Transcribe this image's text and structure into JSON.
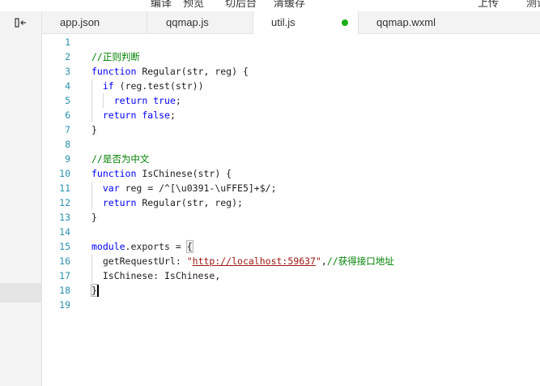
{
  "menu": {
    "items": [
      "编译",
      "预览",
      "切后台",
      "清缓存",
      "上传",
      "测试"
    ]
  },
  "tabs": [
    {
      "label": "app.json",
      "active": false
    },
    {
      "label": "qqmap.js",
      "active": false
    },
    {
      "label": "util.js",
      "active": true,
      "modified": true
    },
    {
      "label": "qqmap.wxml",
      "active": false
    }
  ],
  "editor": {
    "cursor_line": 18,
    "lines": [
      {
        "n": "1",
        "tokens": []
      },
      {
        "n": "2",
        "tokens": [
          {
            "t": "cmt",
            "v": "//正则判断"
          }
        ]
      },
      {
        "n": "3",
        "tokens": [
          {
            "t": "kw",
            "v": "function"
          },
          {
            "t": "",
            "v": " Regular(str, reg) {"
          }
        ]
      },
      {
        "n": "4",
        "tokens": [
          {
            "t": "",
            "v": "  "
          },
          {
            "t": "kw",
            "v": "if"
          },
          {
            "t": "",
            "v": " (reg.test(str))"
          }
        ]
      },
      {
        "n": "5",
        "tokens": [
          {
            "t": "",
            "v": "    "
          },
          {
            "t": "kw",
            "v": "return"
          },
          {
            "t": "",
            "v": " "
          },
          {
            "t": "kw",
            "v": "true"
          },
          {
            "t": "",
            "v": ";"
          }
        ]
      },
      {
        "n": "6",
        "tokens": [
          {
            "t": "",
            "v": "  "
          },
          {
            "t": "kw",
            "v": "return"
          },
          {
            "t": "",
            "v": " "
          },
          {
            "t": "kw",
            "v": "false"
          },
          {
            "t": "",
            "v": ";"
          }
        ]
      },
      {
        "n": "7",
        "tokens": [
          {
            "t": "",
            "v": "}"
          }
        ]
      },
      {
        "n": "8",
        "tokens": []
      },
      {
        "n": "9",
        "tokens": [
          {
            "t": "cmt",
            "v": "//是否为中文"
          }
        ]
      },
      {
        "n": "10",
        "tokens": [
          {
            "t": "kw",
            "v": "function"
          },
          {
            "t": "",
            "v": " IsChinese(str) {"
          }
        ]
      },
      {
        "n": "11",
        "tokens": [
          {
            "t": "",
            "v": "  "
          },
          {
            "t": "kw",
            "v": "var"
          },
          {
            "t": "",
            "v": " reg = /^[\\u0391-\\uFFE5]+$/;"
          }
        ]
      },
      {
        "n": "12",
        "tokens": [
          {
            "t": "",
            "v": "  "
          },
          {
            "t": "kw",
            "v": "return"
          },
          {
            "t": "",
            "v": " Regular(str, reg);"
          }
        ]
      },
      {
        "n": "13",
        "tokens": [
          {
            "t": "",
            "v": "}"
          }
        ]
      },
      {
        "n": "14",
        "tokens": []
      },
      {
        "n": "15",
        "tokens": [
          {
            "t": "kw",
            "v": "module"
          },
          {
            "t": "",
            "v": ".exports = "
          },
          {
            "t": "bracket",
            "v": "{"
          }
        ]
      },
      {
        "n": "16",
        "tokens": [
          {
            "t": "",
            "v": "  getRequestUrl: "
          },
          {
            "t": "str",
            "v": "\""
          },
          {
            "t": "url",
            "v": "http://localhost:59637"
          },
          {
            "t": "str",
            "v": "\""
          },
          {
            "t": "",
            "v": ","
          },
          {
            "t": "cmt",
            "v": "//获得接口地址"
          }
        ]
      },
      {
        "n": "17",
        "tokens": [
          {
            "t": "",
            "v": "  IsChinese: IsChinese,"
          }
        ]
      },
      {
        "n": "18",
        "tokens": [
          {
            "t": "bracket",
            "v": "}"
          }
        ]
      },
      {
        "n": "19",
        "tokens": []
      }
    ]
  },
  "colors": {
    "keyword": "#0000ff",
    "comment": "#008000",
    "string": "#a31515",
    "line_number": "#2b91af",
    "modified_dot": "#1aad19"
  },
  "icons": {
    "sidebar_toggle": "collapse-sidebar-icon"
  }
}
